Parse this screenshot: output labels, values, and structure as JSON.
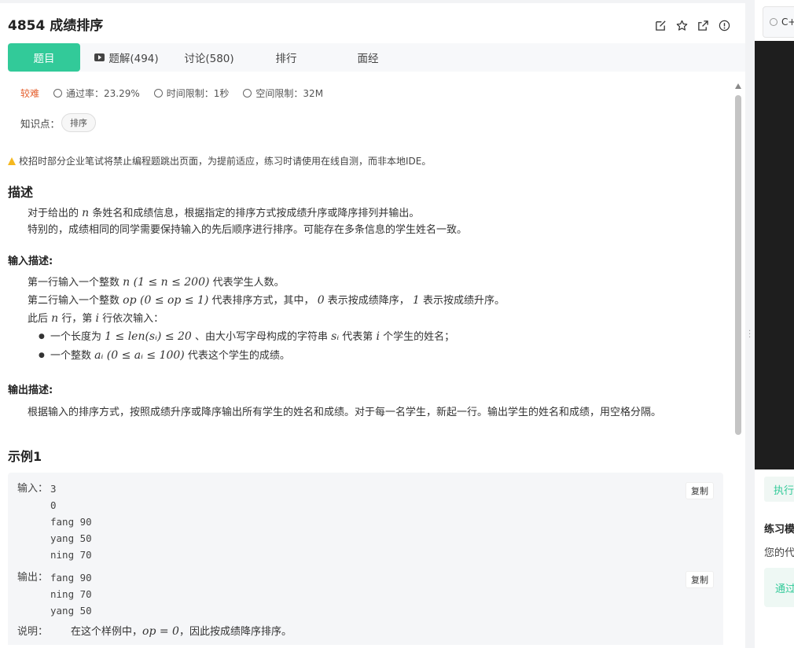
{
  "problem": {
    "title": "4854  成绩排序",
    "tabs": [
      {
        "label": "题目"
      },
      {
        "label": "题解(494)"
      },
      {
        "label": "讨论(580)"
      },
      {
        "label": "排行"
      },
      {
        "label": "面经"
      }
    ],
    "meta": {
      "difficulty": "较难",
      "pass_rate": "通过率：23.29%",
      "time_limit": "时间限制：1秒",
      "space_limit": "空间限制：32M"
    },
    "knowledge_label": "知识点：",
    "knowledge_tag": "排序",
    "warning": "校招时部分企业笔试将禁止编程题跳出页面，为提前适应，练习时请使用在线自测，而非本地IDE。",
    "desc_title": "描述",
    "desc_line1_a": "对于给出的",
    "desc_line1_math": "n",
    "desc_line1_b": "条姓名和成绩信息，根据指定的排序方式按成绩升序或降序排列并输出。",
    "desc_line2": "特别的，成绩相同的同学需要保持输入的先后顺序进行排序。可能存在多条信息的学生姓名一致。",
    "input_title": "输入描述:",
    "input_l1_a": "第一行输入一个整数",
    "input_l1_math": "n (1 ≤ n ≤ 200)",
    "input_l1_b": "代表学生人数。",
    "input_l2_a": "第二行输入一个整数",
    "input_l2_math": "op (0 ≤ op ≤ 1)",
    "input_l2_b": "代表排序方式，其中，",
    "input_l2_m2": "0",
    "input_l2_c": "表示按成绩降序，",
    "input_l2_m3": "1",
    "input_l2_d": "表示按成绩升序。",
    "input_l3_a": "此后",
    "input_l3_m1": "n",
    "input_l3_b": "行，第",
    "input_l3_m2": "i",
    "input_l3_c": "行依次输入：",
    "input_b1_a": "一个长度为",
    "input_b1_math": "1 ≤ len(sᵢ) ≤ 20",
    "input_b1_b": "、由大小写字母构成的字符串",
    "input_b1_m2": "sᵢ",
    "input_b1_c": "代表第",
    "input_b1_m3": "i",
    "input_b1_d": "个学生的姓名；",
    "input_b2_a": "一个整数",
    "input_b2_math": "aᵢ (0 ≤ aᵢ ≤ 100)",
    "input_b2_b": "代表这个学生的成绩。",
    "output_title": "输出描述:",
    "output_text": "根据输入的排序方式，按照成绩升序或降序输出所有学生的姓名和成绩。对于每一名学生，新起一行。输出学生的姓名和成绩，用空格分隔。",
    "example_title": "示例1",
    "example": {
      "input_label": "输入：",
      "input_code": "3\n0\nfang 90\nyang 50\nning 70",
      "output_label": "输出：",
      "output_code": "fang 90\nning 70\nyang 50",
      "note_label": "说明：",
      "note_a": "在这个样例中，",
      "note_math": "op = 0",
      "note_b": "，因此按成绩降序排序。",
      "copy_label": "复制"
    }
  },
  "right": {
    "lang": "C+",
    "run": "执行",
    "mode": "练习模",
    "code_status": "您的代",
    "pass": "通过"
  },
  "colors": {
    "accent": "#32ca99",
    "difficulty": "#e5602f",
    "warning": "#f5b81f"
  }
}
